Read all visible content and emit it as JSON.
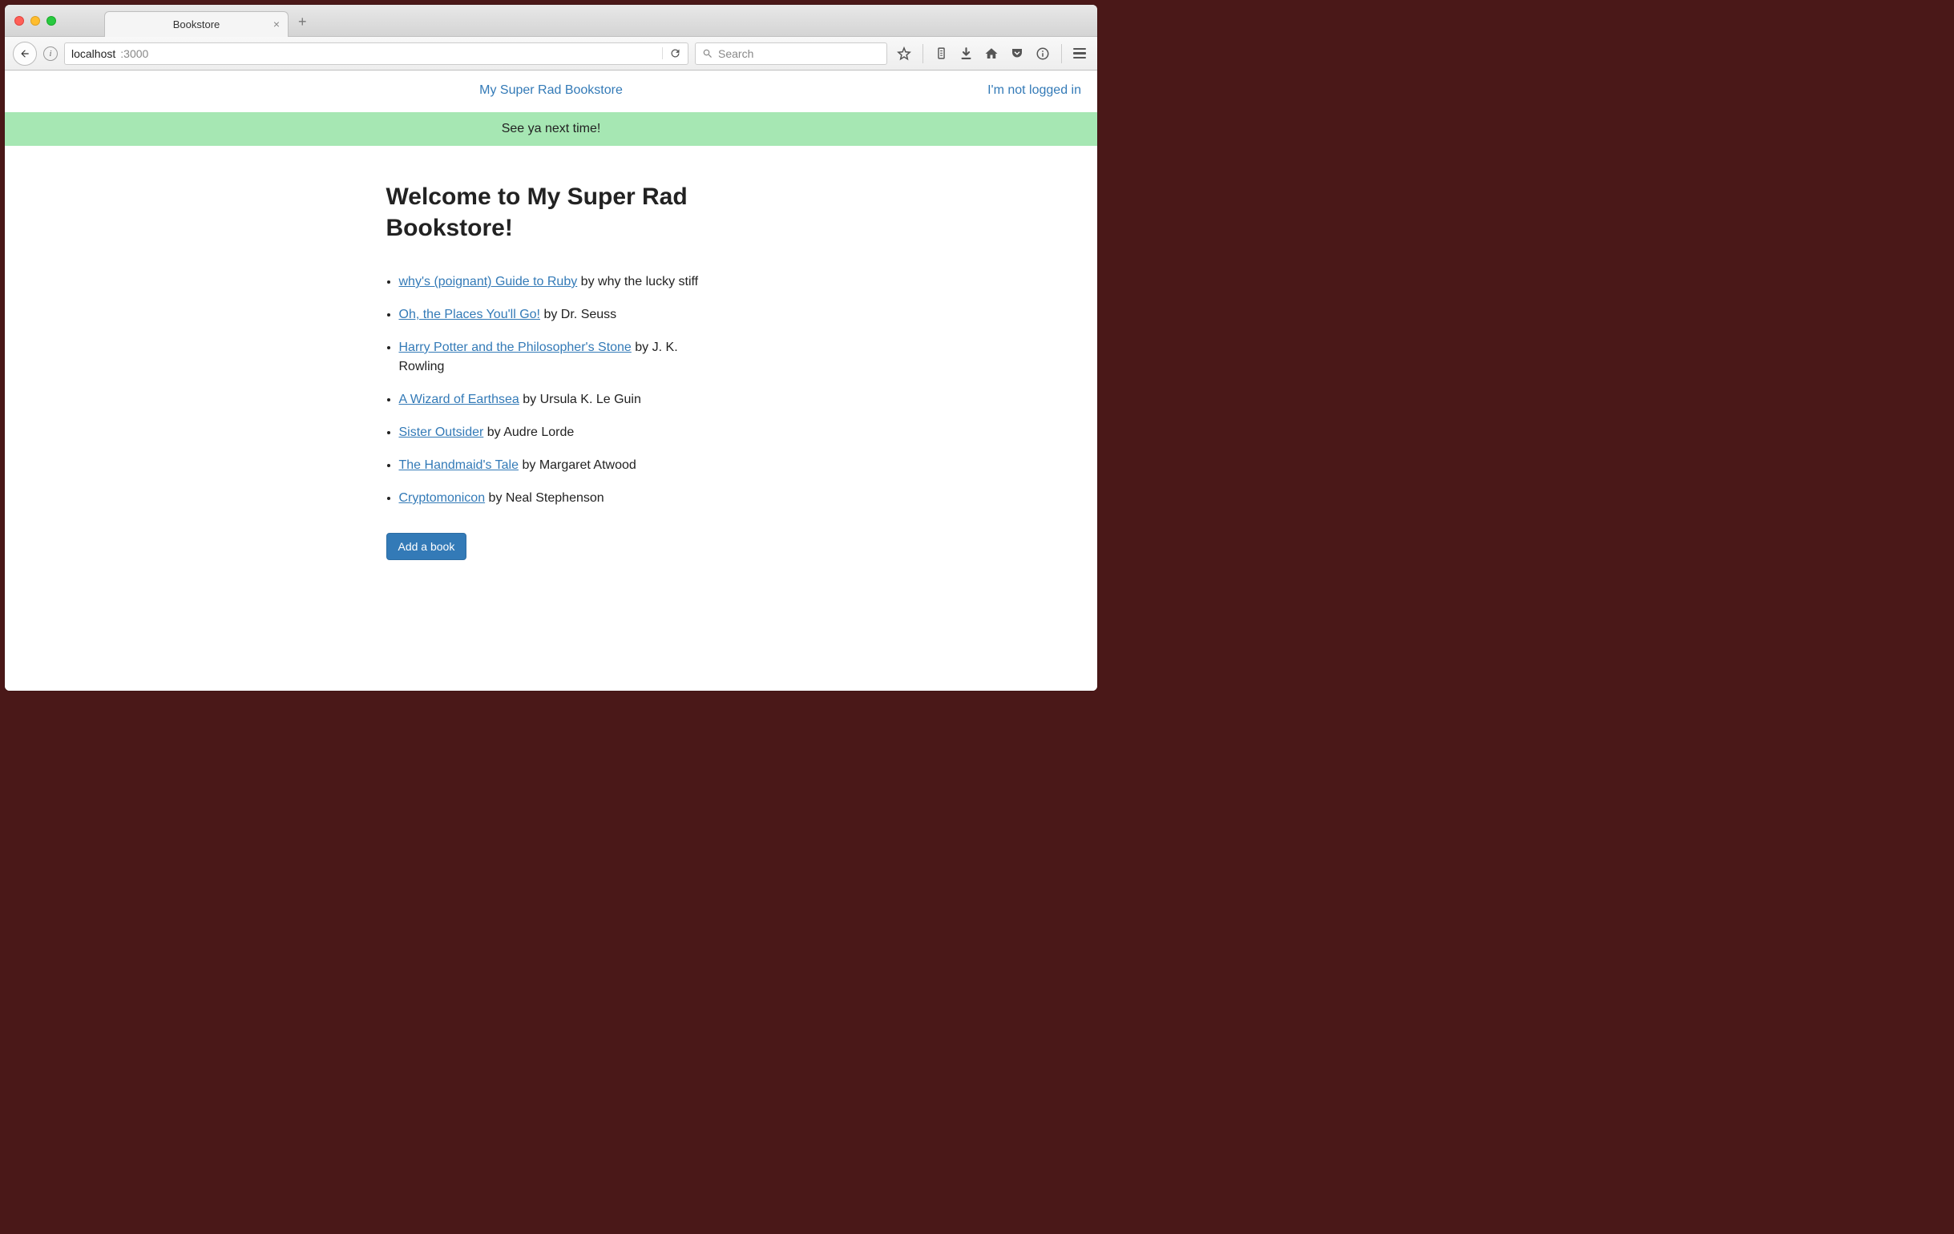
{
  "browser": {
    "tab_title": "Bookstore",
    "url_host": "localhost",
    "url_port": ":3000",
    "search_placeholder": "Search"
  },
  "nav": {
    "brand": "My Super Rad Bookstore",
    "login_status": "I'm not logged in"
  },
  "flash_message": "See ya next time!",
  "heading": "Welcome to My Super Rad Bookstore!",
  "by_word": " by ",
  "books": [
    {
      "title": "why's (poignant) Guide to Ruby",
      "author": "why the lucky stiff"
    },
    {
      "title": "Oh, the Places You'll Go!",
      "author": "Dr. Seuss"
    },
    {
      "title": "Harry Potter and the Philosopher's Stone",
      "author": "J. K. Rowling"
    },
    {
      "title": "A Wizard of Earthsea",
      "author": "Ursula K. Le Guin"
    },
    {
      "title": "Sister Outsider",
      "author": "Audre Lorde"
    },
    {
      "title": "The Handmaid's Tale",
      "author": "Margaret Atwood"
    },
    {
      "title": "Cryptomonicon",
      "author": "Neal Stephenson"
    }
  ],
  "add_button": "Add a book"
}
